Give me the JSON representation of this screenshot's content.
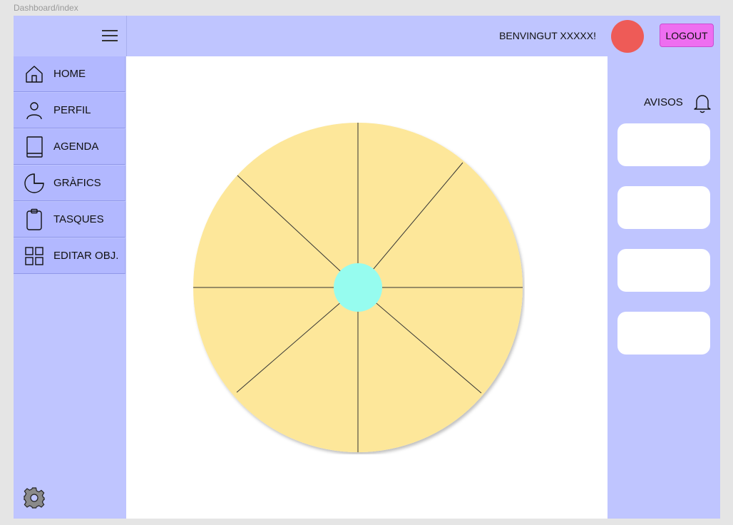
{
  "frame": {
    "label": "Dashboard/index"
  },
  "header": {
    "welcome_text": "BENVINGUT XXXXX!",
    "avatar_color": "#ee5b57",
    "logout_label": "LOGOUT",
    "logout_color": "#ee6ef0",
    "menu_icon": "hamburger-icon"
  },
  "sidebar": {
    "items": [
      {
        "label": "HOME",
        "icon": "home-icon"
      },
      {
        "label": "PERFIL",
        "icon": "user-icon"
      },
      {
        "label": "AGENDA",
        "icon": "book-icon"
      },
      {
        "label": "GRÀFICS",
        "icon": "pie-chart-icon"
      },
      {
        "label": "TASQUES",
        "icon": "clipboard-icon"
      },
      {
        "label": "EDITAR OBJ.",
        "icon": "grid-icon"
      }
    ],
    "settings_icon": "gear-icon"
  },
  "notices": {
    "title": "AVISOS",
    "icon": "bell-icon",
    "cards": [
      "",
      "",
      "",
      ""
    ]
  },
  "wheel": {
    "segments": 8,
    "fill_color": "#fde79a",
    "center_color": "#96fcef"
  },
  "colors": {
    "panel": "#bfc5ff",
    "nav_item": "#b2b8ff",
    "content_bg": "#ffffff"
  }
}
